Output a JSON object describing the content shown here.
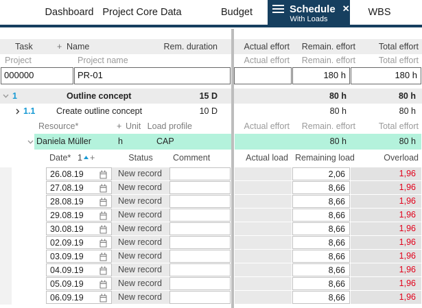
{
  "colors": {
    "tab_active_bg": "#163f5f",
    "accent_blue": "#189ad4",
    "selection_mint": "#b4f2dc",
    "overload_red": "#e2001a",
    "row_gray": "#ebebeb",
    "cell_gray": "#e9e9e9",
    "overload_cell_gray": "#e2e2e2"
  },
  "tabs": {
    "items": [
      {
        "label": "Dashboard"
      },
      {
        "label": "Project Core Data"
      },
      {
        "label": "Budget"
      },
      {
        "label": "Schedule",
        "sublabel": "With Loads",
        "close": "✕",
        "active": true
      },
      {
        "label": "WBS"
      }
    ]
  },
  "table": {
    "header1": {
      "task": "Task",
      "plus": "+",
      "name": "Name",
      "rem_duration": "Rem. duration",
      "actual_effort": "Actual effort",
      "remain_effort": "Remain. effort",
      "total_effort": "Total effort"
    },
    "header2": {
      "project": "Project",
      "project_name": "Project name",
      "actual_effort": "Actual effort",
      "remain_effort": "Remain. effort",
      "total_effort": "Total effort"
    },
    "project_row": {
      "id": "000000",
      "name": "PR-01",
      "actual_effort": "",
      "remain_effort": "180 h",
      "total_effort": "180 h"
    },
    "task_rows": [
      {
        "wbs": "1",
        "name": "Outline concept",
        "rem_duration": "15 D",
        "remain_effort": "80 h",
        "total_effort": "80 h"
      },
      {
        "wbs": "1.1",
        "name": "Create outline concept",
        "rem_duration": "10 D",
        "remain_effort": "80 h",
        "total_effort": "80 h"
      }
    ],
    "resource_header": {
      "resource": "Resource*",
      "plus": "+",
      "unit": "Unit",
      "load_profile": "Load profile",
      "actual_effort": "Actual effort",
      "remain_effort": "Remain. effort",
      "total_effort": "Total effort"
    },
    "resource_row": {
      "name": "Daniela Müller",
      "unit": "h",
      "load_profile": "CAP",
      "remain_effort": "80 h",
      "total_effort": "80 h"
    },
    "load_header": {
      "date": "Date*",
      "sort_level": "1",
      "plus": "+",
      "status": "Status",
      "comment": "Comment",
      "actual_load": "Actual load",
      "remaining_load": "Remaining load",
      "overload": "Overload"
    },
    "load_rows": [
      {
        "date": "26.08.19",
        "status": "New record",
        "comment": "",
        "actual_load": "",
        "remaining_load": "2,06",
        "overload": "1,96"
      },
      {
        "date": "27.08.19",
        "status": "New record",
        "comment": "",
        "actual_load": "",
        "remaining_load": "8,66",
        "overload": "1,96"
      },
      {
        "date": "28.08.19",
        "status": "New record",
        "comment": "",
        "actual_load": "",
        "remaining_load": "8,66",
        "overload": "1,96"
      },
      {
        "date": "29.08.19",
        "status": "New record",
        "comment": "",
        "actual_load": "",
        "remaining_load": "8,66",
        "overload": "1,96"
      },
      {
        "date": "30.08.19",
        "status": "New record",
        "comment": "",
        "actual_load": "",
        "remaining_load": "8,66",
        "overload": "1,96"
      },
      {
        "date": "02.09.19",
        "status": "New record",
        "comment": "",
        "actual_load": "",
        "remaining_load": "8,66",
        "overload": "1,96"
      },
      {
        "date": "03.09.19",
        "status": "New record",
        "comment": "",
        "actual_load": "",
        "remaining_load": "8,66",
        "overload": "1,96"
      },
      {
        "date": "04.09.19",
        "status": "New record",
        "comment": "",
        "actual_load": "",
        "remaining_load": "8,66",
        "overload": "1,96"
      },
      {
        "date": "05.09.19",
        "status": "New record",
        "comment": "",
        "actual_load": "",
        "remaining_load": "8,66",
        "overload": "1,96"
      },
      {
        "date": "06.09.19",
        "status": "New record",
        "comment": "",
        "actual_load": "",
        "remaining_load": "8,66",
        "overload": "1,96"
      }
    ]
  }
}
